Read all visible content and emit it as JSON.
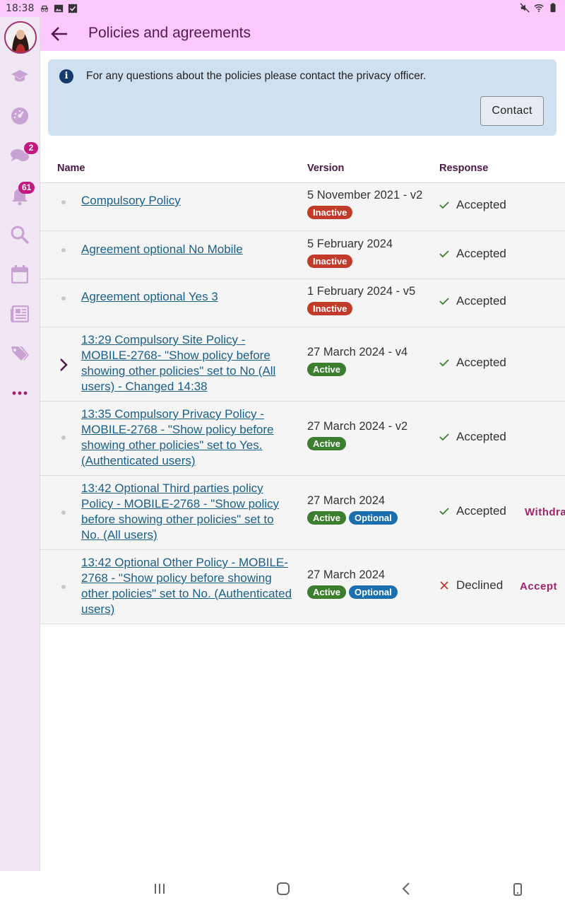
{
  "statusbar": {
    "time": "18:38"
  },
  "sidebar": {
    "messages_badge": "2",
    "notifications_badge": "61"
  },
  "header": {
    "title": "Policies and agreements"
  },
  "info": {
    "text": "For any questions about the policies please contact the privacy officer.",
    "contact_label": "Contact"
  },
  "table": {
    "headers": {
      "name": "Name",
      "version": "Version",
      "response": "Response"
    },
    "rows": [
      {
        "name": "Compulsory Policy",
        "version": "5 November 2021 - v2",
        "status": "Inactive",
        "response": "Accepted"
      },
      {
        "name": "Agreement optional No Mobile",
        "version": "5 February 2024",
        "status": "Inactive",
        "response": "Accepted"
      },
      {
        "name": "Agreement optional Yes 3",
        "version": "1 February 2024 - v5",
        "status": "Inactive",
        "response": "Accepted"
      },
      {
        "name": "13:29 Compulsory Site Policy - MOBILE-2768- \"Show policy before showing other policies\" set to No (All users) - Changed 14:38",
        "version": "27 March 2024 - v4",
        "status": "Active",
        "response": "Accepted"
      },
      {
        "name": "13:35 Compulsory Privacy Policy - MOBILE-2768 - \"Show policy before showing other policies\" set to Yes. (Authenticated users)",
        "version": "27 March 2024 - v2",
        "status": "Active",
        "response": "Accepted"
      },
      {
        "name": "13:42 Optional Third parties policy Policy - MOBILE-2768 - \"Show policy before showing other policies\" set to No. (All users)",
        "version": "27 March 2024",
        "status": "Active",
        "optional": "Optional",
        "response": "Accepted",
        "action": "Withdra"
      },
      {
        "name": "13:42 Optional Other Policy - MOBILE-2768 - \"Show policy before showing other policies\" set to No. (Authenticated users)",
        "version": "27 March 2024",
        "status": "Active",
        "optional": "Optional",
        "response": "Declined",
        "action": "Accept"
      }
    ]
  },
  "colors": {
    "header_bg": "#fbc9fb",
    "accent": "#a0246c",
    "link": "#1a5f8a",
    "inactive": "#c23a2a",
    "active": "#3a7e2e",
    "optional": "#1b6fae",
    "info_bg": "#cfe0f0"
  }
}
